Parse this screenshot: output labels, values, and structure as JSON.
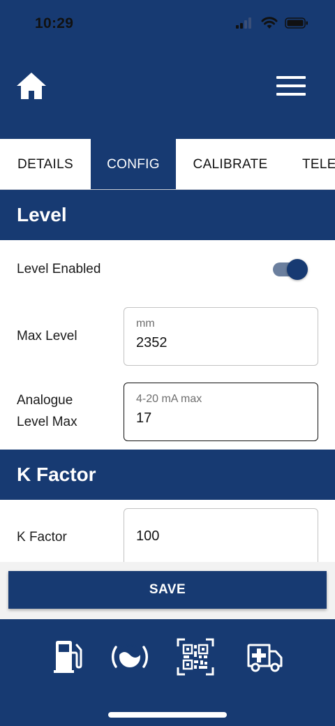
{
  "status_bar": {
    "time": "10:29"
  },
  "header": {
    "home_icon": "home-icon",
    "menu_icon": "hamburger-menu-icon"
  },
  "tabs": [
    {
      "label": "DETAILS",
      "active": false
    },
    {
      "label": "CONFIG",
      "active": true
    },
    {
      "label": "CALIBRATE",
      "active": false
    },
    {
      "label": "TELE",
      "active": false
    }
  ],
  "sections": {
    "level": {
      "title": "Level",
      "level_enabled": {
        "label": "Level Enabled",
        "on": true
      },
      "max_level": {
        "label": "Max Level",
        "hint": "mm",
        "value": "2352"
      },
      "analogue_level_max": {
        "label_line1": "Analogue",
        "label_line2": "Level Max",
        "hint": "4-20 mA max",
        "value": "17"
      }
    },
    "k_factor": {
      "title": "K Factor",
      "k_factor": {
        "label": "K Factor",
        "value": "100"
      }
    }
  },
  "save_button": {
    "label": "SAVE"
  },
  "bottom_nav": [
    "fuel-pump-icon",
    "tank-level-icon",
    "qr-code-icon",
    "ambulance-icon"
  ],
  "colors": {
    "primary": "#173a72",
    "white": "#ffffff",
    "toggle_track": "#6b7f9e"
  }
}
